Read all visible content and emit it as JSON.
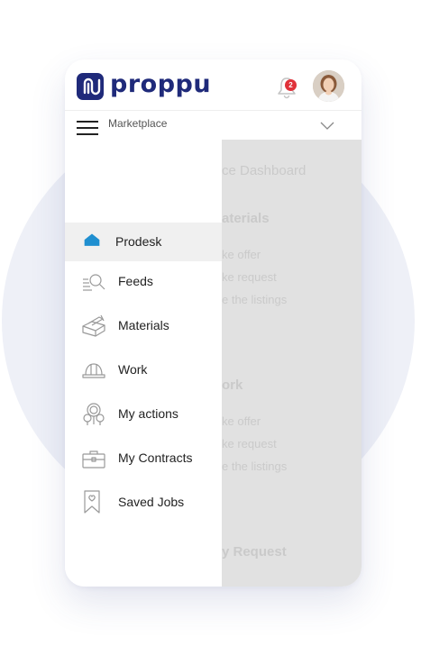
{
  "app": {
    "logo_text": "proppu",
    "notification_count": "2",
    "section_title": "Marketplace"
  },
  "drawer": {
    "items": [
      {
        "label": "Prodesk",
        "icon": "home-icon",
        "active": true
      },
      {
        "label": "Feeds",
        "icon": "feeds-search-icon"
      },
      {
        "label": "Materials",
        "icon": "materials-box-icon"
      },
      {
        "label": "Work",
        "icon": "hard-hat-icon"
      },
      {
        "label": "My actions",
        "icon": "actions-icon"
      },
      {
        "label": "My Contracts",
        "icon": "briefcase-icon"
      },
      {
        "label": "Saved Jobs",
        "icon": "bookmark-heart-icon"
      }
    ]
  },
  "background_page": {
    "dashboard_title": "ce Dashboard",
    "materials": {
      "heading": "aterials",
      "links": [
        "ke offer",
        "ke request",
        "e the listings"
      ]
    },
    "work": {
      "heading": "ork",
      "links": [
        "ke offer",
        "ke request",
        "e the listings"
      ]
    },
    "request_heading": "y Request"
  },
  "colors": {
    "brand": "#1f2a7a",
    "active_icon": "#1f8fd0",
    "badge": "#e0323a"
  }
}
